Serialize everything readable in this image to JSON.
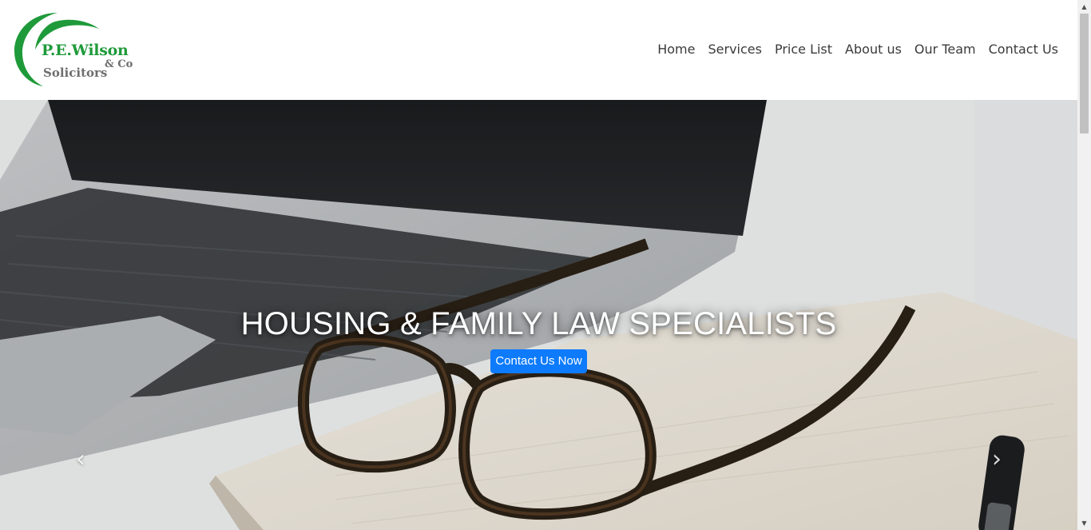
{
  "brand": {
    "name": "P.E.Wilson",
    "suffix": "& Co",
    "subtitle": "Solicitors",
    "green": "#1f9a3a",
    "grey": "#6e6e6e"
  },
  "nav": {
    "items": [
      {
        "label": "Home"
      },
      {
        "label": "Services"
      },
      {
        "label": "Price List"
      },
      {
        "label": "About us"
      },
      {
        "label": "Our Team"
      },
      {
        "label": "Contact Us"
      }
    ]
  },
  "hero": {
    "title": "HOUSING & FAMILY LAW SPECIALISTS",
    "button_label": "Contact Us Now",
    "button_color": "#0d7bfb",
    "prev_icon": "chevron-left-icon",
    "next_icon": "chevron-right-icon",
    "prev_glyph": "‹",
    "next_glyph": "›"
  },
  "scrollbar": {
    "up_glyph": "▲",
    "down_glyph": "▼"
  }
}
